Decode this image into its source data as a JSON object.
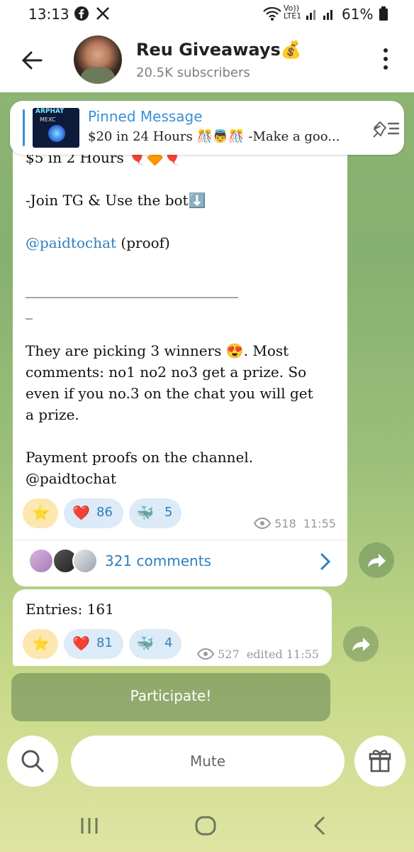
{
  "status_bar": {
    "time": "13:13",
    "lte": "Vo)) LTE1",
    "battery": "61%"
  },
  "header": {
    "title": "Reu Giveaways💰",
    "subtitle": "20.5K subscribers"
  },
  "pinned": {
    "title": "Pinned Message",
    "text": "$20 in 24 Hours 🎊👼🎊 -Make a goo...",
    "thumb_title": "ARPHAT",
    "thumb_sub": "MEXC"
  },
  "post1": {
    "lines": [
      "$5 in 2 Hours 🎈🔶🎈",
      "-Join TG & Use the bot⬇️",
      "@paidtochat",
      " (proof)",
      "______________________________",
      "_",
      "They are picking 3 winners 😍. Most",
      "comments: no1 no2 no3 get a prize. So",
      "even if you no.3 on the chat you will get",
      "a prize.",
      "Payment proofs on the channel.",
      "@paidtochat"
    ],
    "reactions": [
      {
        "emoji": "⭐",
        "count": ""
      },
      {
        "emoji": "❤️",
        "count": "86"
      },
      {
        "emoji": "🐳",
        "count": "5"
      }
    ],
    "views": "518",
    "time": "11:55",
    "comments_label": "321 comments"
  },
  "post2": {
    "text": "Entries: 161",
    "reactions": [
      {
        "emoji": "⭐",
        "count": ""
      },
      {
        "emoji": "❤️",
        "count": "81"
      },
      {
        "emoji": "🐳",
        "count": "4"
      }
    ],
    "views": "527",
    "edited_time": "edited 11:55"
  },
  "participate_label": "Participate!",
  "bottom": {
    "mute_label": "Mute"
  },
  "colors": {
    "accent": "#3a8fd6",
    "link": "#2f7fbf",
    "heart": "#e0243a"
  }
}
